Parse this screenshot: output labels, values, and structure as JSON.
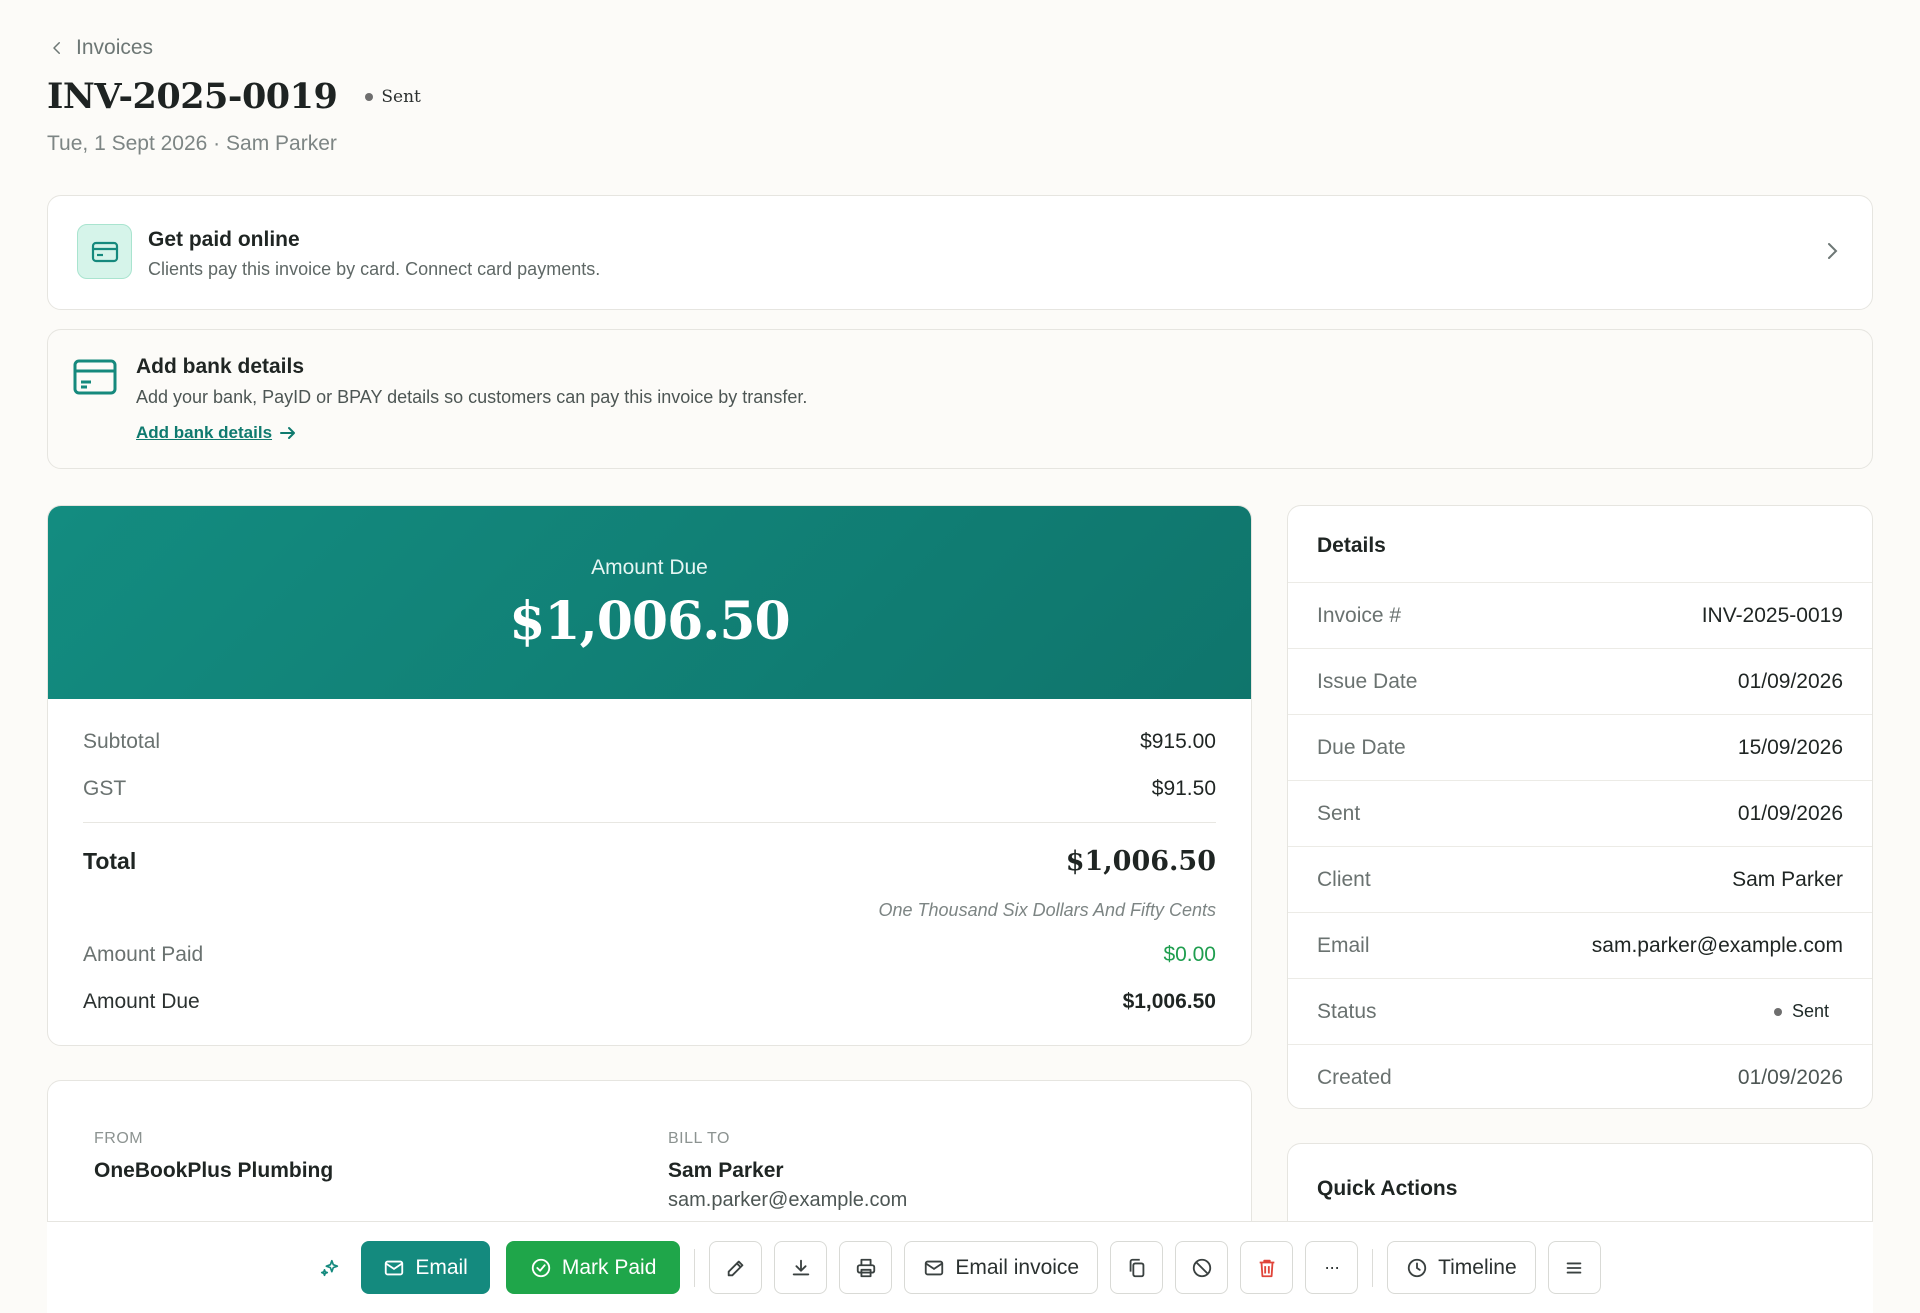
{
  "nav": {
    "back_label": "Invoices"
  },
  "header": {
    "title": "INV-2025-0019",
    "status": "Sent",
    "subtitle": "Tue, 1 Sept 2026 · Sam Parker"
  },
  "banners": {
    "online": {
      "title": "Get paid online",
      "description": "Clients pay this invoice by card. Connect card payments."
    },
    "bank": {
      "title": "Add bank details",
      "description": "Add your bank, PayID or BPAY details so customers can pay this invoice by transfer.",
      "link": "Add bank details"
    }
  },
  "summary": {
    "hero_label": "Amount Due",
    "hero_amount": "$1,006.50",
    "subtotal_label": "Subtotal",
    "subtotal": "$915.00",
    "gst_label": "GST",
    "gst": "$91.50",
    "total_label": "Total",
    "total": "$1,006.50",
    "total_words": "One Thousand Six Dollars And Fifty Cents",
    "paid_label": "Amount Paid",
    "paid": "$0.00",
    "due_label": "Amount Due",
    "due": "$1,006.50"
  },
  "parties": {
    "from_label": "FROM",
    "from_name": "OneBookPlus Plumbing",
    "to_label": "BILL TO",
    "to_name": "Sam Parker",
    "to_email": "sam.parker@example.com"
  },
  "details": {
    "title": "Details",
    "rows": [
      {
        "label": "Invoice #",
        "value": "INV-2025-0019"
      },
      {
        "label": "Issue Date",
        "value": "01/09/2026"
      },
      {
        "label": "Due Date",
        "value": "15/09/2026"
      },
      {
        "label": "Sent",
        "value": "01/09/2026"
      },
      {
        "label": "Client",
        "value": "Sam Parker"
      },
      {
        "label": "Email",
        "value": "sam.parker@example.com"
      },
      {
        "label": "Status",
        "value": "Sent"
      },
      {
        "label": "Created",
        "value": "01/09/2026"
      }
    ]
  },
  "quick_actions": {
    "title": "Quick Actions"
  },
  "actions": {
    "email": "Email",
    "mark_paid": "Mark Paid",
    "email_invoice": "Email invoice",
    "more": "···",
    "timeline": "Timeline"
  },
  "colors": {
    "accent": "#148a7e",
    "success": "#1fa64a",
    "paid_green": "#1f9e4f",
    "danger": "#e0453a"
  }
}
